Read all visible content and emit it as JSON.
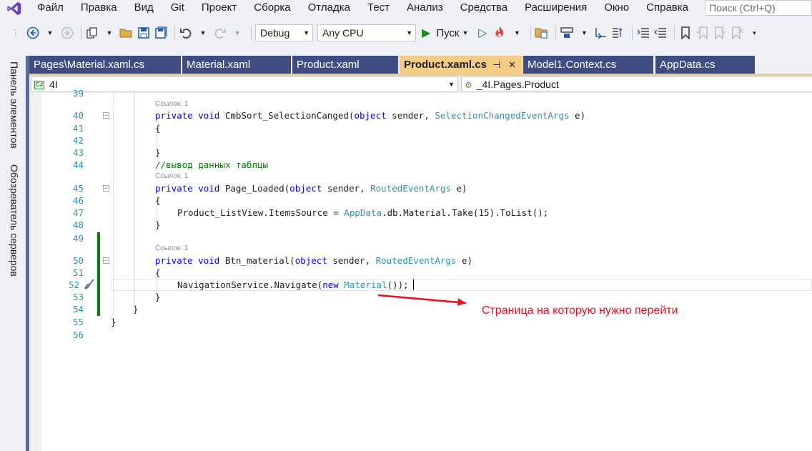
{
  "menubar": {
    "items": [
      "Файл",
      "Правка",
      "Вид",
      "Git",
      "Проект",
      "Сборка",
      "Отладка",
      "Тест",
      "Анализ",
      "Средства",
      "Расширения",
      "Окно",
      "Справка"
    ],
    "search_placeholder": "Поиск (Ctrl+Q)"
  },
  "toolbar": {
    "config": "Debug",
    "platform": "Any CPU",
    "run_label": "Пуск"
  },
  "left_rail": {
    "toolbox": "Панель элементов",
    "server_explorer": "Обозреватель серверов"
  },
  "tabs": [
    {
      "label": "Pages\\Material.xaml.cs",
      "active": false
    },
    {
      "label": "Material.xaml",
      "active": false
    },
    {
      "label": "Product.xaml",
      "active": false
    },
    {
      "label": "Product.xaml.cs",
      "active": true
    },
    {
      "label": "Model1.Context.cs",
      "active": false
    },
    {
      "label": "AppData.cs",
      "active": false
    }
  ],
  "navbar": {
    "project": "4I",
    "project_badge": "C#",
    "class": "_4I.Pages.Product"
  },
  "editor": {
    "line_numbers": [
      "39",
      "40",
      "41",
      "42",
      "43",
      "44",
      "45",
      "46",
      "47",
      "48",
      "49",
      "50",
      "51",
      "52",
      "53",
      "54",
      "55",
      "56"
    ],
    "lens_label": "Ссылок: 1",
    "lines": {
      "l40": {
        "kw1": "private",
        "kw2": "void",
        "name": " CmbSort_SelectionCanged(",
        "kw3": "object",
        "mid": " sender, ",
        "ty": "SelectionChangedEventArgs",
        "end": " e)"
      },
      "l41": "{",
      "l43": "}",
      "l44": "//вывод данных таблцы",
      "l45": {
        "kw1": "private",
        "kw2": "void",
        "name": " Page_Loaded(",
        "kw3": "object",
        "mid": " sender, ",
        "ty": "RoutedEventArgs",
        "end": " e)"
      },
      "l46": "{",
      "l47": {
        "a": "Product_ListView.ItemsSource = ",
        "ty": "AppData",
        "b": ".db.Material.Take(15).ToList();"
      },
      "l48": "}",
      "l50": {
        "kw1": "private",
        "kw2": "void",
        "name": " Btn_material(",
        "kw3": "object",
        "mid": " sender, ",
        "ty": "RoutedEventArgs",
        "end": " e)"
      },
      "l51": "{",
      "l52": {
        "a": "NavigationService.Navigate(",
        "kw": "new",
        "sp": " ",
        "ty": "Material",
        "b": "());"
      },
      "l53": "}",
      "l54": "}",
      "l55": "}"
    }
  },
  "annotation": {
    "text": "Страница на которую нужно перейти",
    "color": "#e81123"
  },
  "colors": {
    "tab_inactive": "#3f4e82",
    "tab_active": "#f5cc84",
    "keyword": "#0000ff",
    "type": "#2b91af",
    "comment": "#008000",
    "change_bar": "#107c10"
  }
}
